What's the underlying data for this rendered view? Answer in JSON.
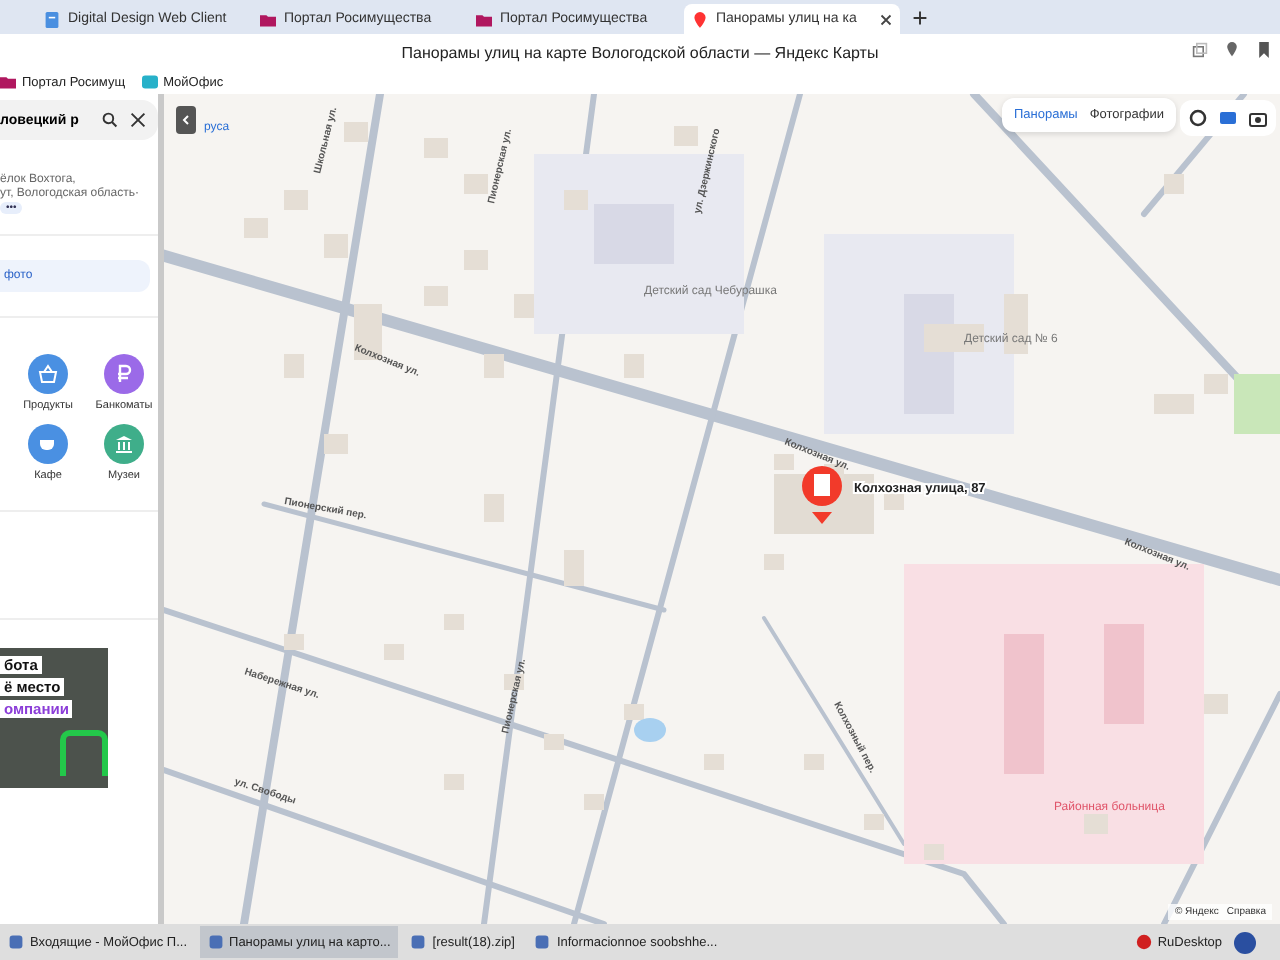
{
  "browser": {
    "tabs": [
      {
        "label": "Digital Design Web Client",
        "kind": "doc",
        "selected": false
      },
      {
        "label": "Портал Росимущества",
        "kind": "folder",
        "selected": false
      },
      {
        "label": "Портал Росимущества",
        "kind": "folder",
        "selected": false
      },
      {
        "label": "Панорамы улиц на ка",
        "kind": "pin",
        "selected": true
      }
    ],
    "title": "Панорамы улиц на карте Вологодской области — Яндекс Карты",
    "bookmarks": [
      {
        "label": "Портал Росимущ",
        "kind": "folder"
      },
      {
        "label": "МойОфис",
        "kind": "office"
      }
    ]
  },
  "sidebar": {
    "search": {
      "value": "ловецкий р"
    },
    "address": [
      "ёлок Вохтога,",
      "ут, Вологодская область·"
    ],
    "more": "•••",
    "photo_button": "фото",
    "categories": [
      {
        "label": "Продукты",
        "kind": "basket",
        "color": "#4a90e2"
      },
      {
        "label": "Банкоматы",
        "kind": "ruble",
        "color": "#9b6ae8"
      },
      {
        "label": "Кафе",
        "kind": "cup",
        "color": "#4a90e2"
      },
      {
        "label": "Музеи",
        "kind": "museum",
        "color": "#3fae8a"
      }
    ],
    "ad": [
      "бота",
      "ё место",
      "омпании"
    ]
  },
  "map": {
    "tabs": [
      {
        "label": "Панорамы",
        "selected": true
      },
      {
        "label": "Фотографии",
        "selected": false
      }
    ],
    "labels": [
      "Колхозная ул.",
      "Колхозная ул.",
      "Школьная ул.",
      "Пионерская ул.",
      "ул. Дзержинского",
      "Пионерский пер.",
      "Набережная ул.",
      "ул. Свободы",
      "Колхозный пер.",
      "Пионерская ул.",
      "Колхозная ул."
    ],
    "pois": [
      "Детский сад Чебурашка",
      "Детский сад № 6",
      "Районная больница",
      "руса"
    ],
    "pin": "Колхозная улица, 87",
    "footer": [
      "© Яндекс",
      "Справка"
    ]
  },
  "taskbar": {
    "items": [
      {
        "label": "Входящие - МойОфис П...",
        "selected": false
      },
      {
        "label": "Панорамы улиц на карто...",
        "selected": true
      },
      {
        "label": "[result(18).zip]",
        "selected": false
      },
      {
        "label": "Informacionnoe soobshhe...",
        "selected": false
      }
    ],
    "tray": "RuDesktop"
  }
}
